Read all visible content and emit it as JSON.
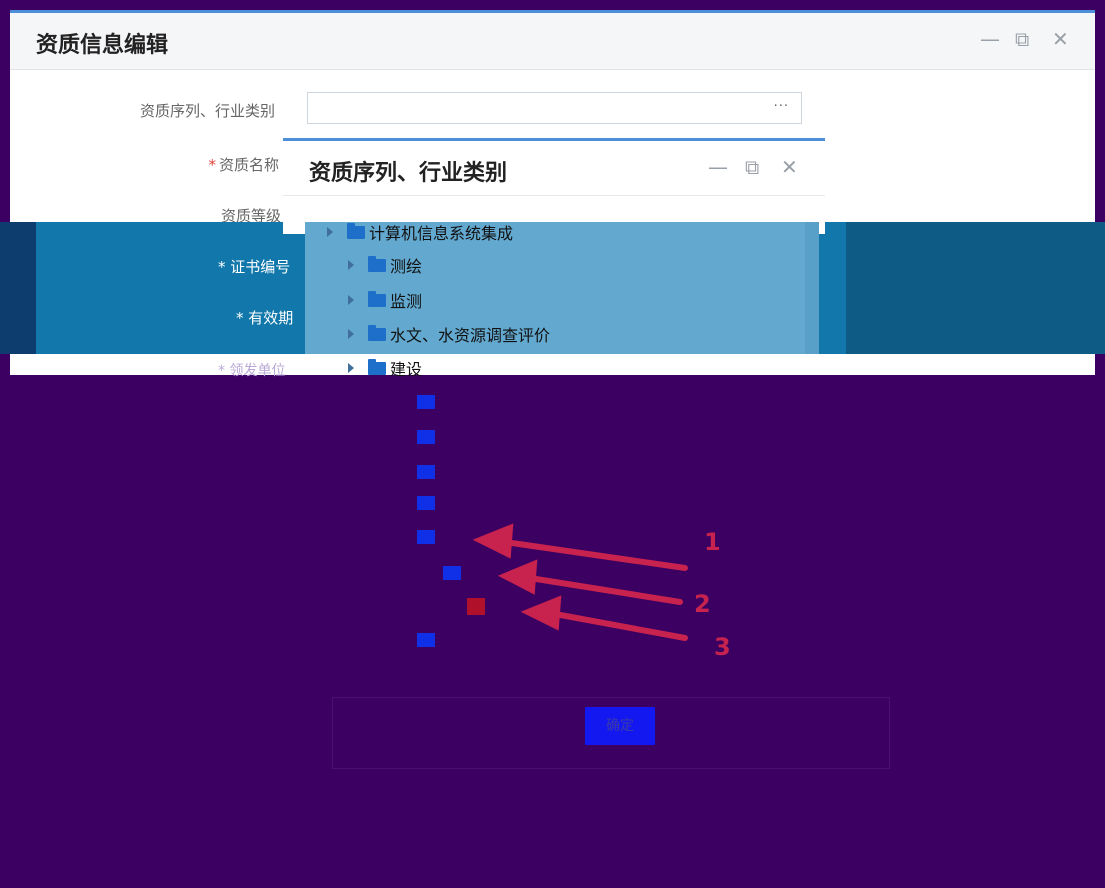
{
  "main_dialog": {
    "title": "资质信息编辑",
    "controls": {
      "minimize": "—",
      "maximize": "⧉",
      "close": "✕"
    },
    "fields": [
      {
        "label": "资质序列、行业类别",
        "required": false
      },
      {
        "label": "资质名称",
        "required": true
      },
      {
        "label": "资质等级",
        "required": false
      },
      {
        "label": "证书编号",
        "required": true
      },
      {
        "label": "有效期",
        "required": true
      },
      {
        "label": "领发单位",
        "required": true
      }
    ],
    "series_field": {
      "value": "",
      "button_text": "···"
    }
  },
  "sub_dialog": {
    "title": "资质序列、行业类别",
    "controls": {
      "minimize": "—",
      "maximize": "⧉",
      "close": "✕"
    },
    "tree": [
      {
        "label": "计算机信息系统集成"
      },
      {
        "label": "测绘"
      },
      {
        "label": "监测"
      },
      {
        "label": "水文、水资源调查评价"
      },
      {
        "label": "建设"
      }
    ]
  },
  "annotations": {
    "arrow_1": "1",
    "arrow_2": "2",
    "arrow_3": "3"
  },
  "footer": {
    "confirm_label": "确定"
  },
  "colors": {
    "accent": "#4d8ed9",
    "overlay_teal": "#1277aa",
    "background": "#3b0062",
    "arrow": "#c8224e"
  }
}
